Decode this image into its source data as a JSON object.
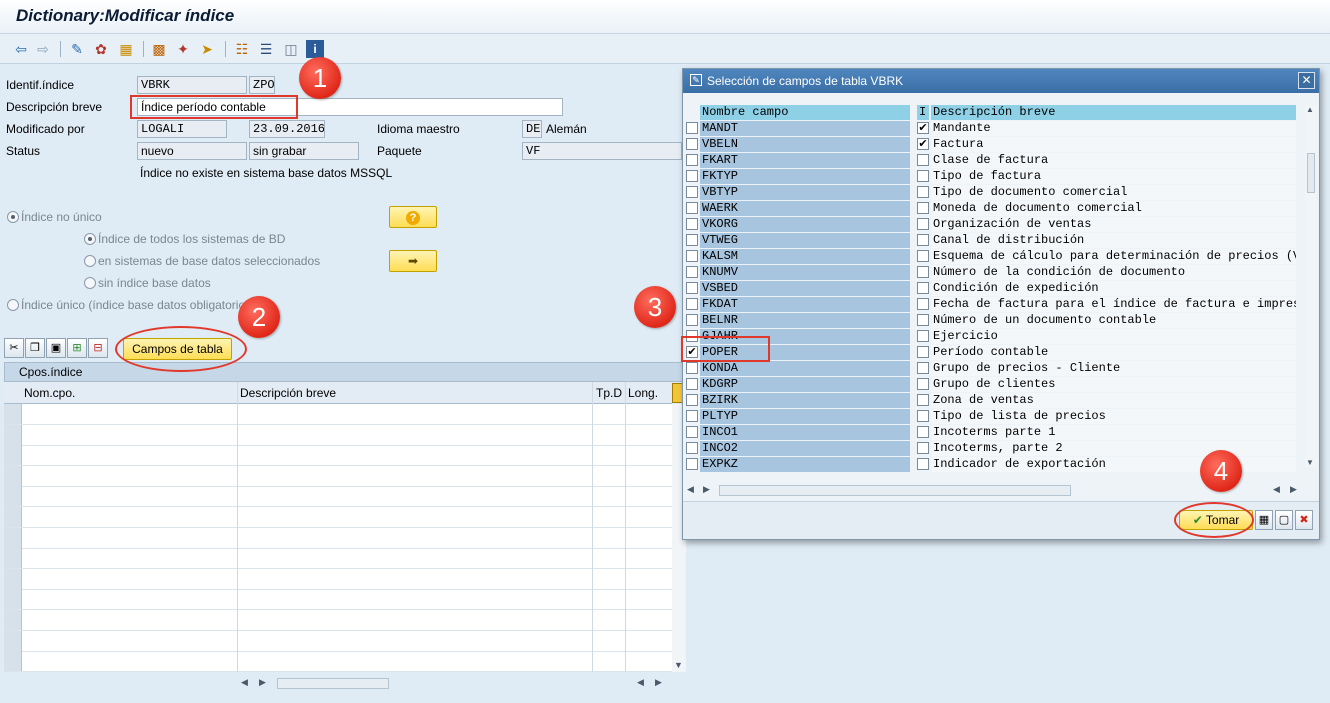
{
  "window": {
    "title": "Dictionary:Modificar índice"
  },
  "toolbar": {
    "icons": [
      "back-arrow-icon",
      "forward-arrow-icon",
      "display-change-icon",
      "activate-icon",
      "object-list-icon",
      "hierarchy-icon",
      "magic-wand-icon",
      "navigate-icon",
      "tree-icon",
      "list-icon",
      "layout-icon",
      "info-icon"
    ]
  },
  "form": {
    "id_label": "Identif.índice",
    "id_value1": "VBRK",
    "id_value2": "ZPO",
    "desc_label": "Descripción breve",
    "desc_value": "Índice período contable",
    "mod_label": "Modificado por",
    "mod_user": "LOGALI",
    "mod_date": "23.09.2016",
    "lang_label": "Idioma maestro",
    "lang_code": "DE",
    "lang_name": "Alemán",
    "status_label": "Status",
    "status_value1": "nuevo",
    "status_value2": "sin grabar",
    "package_label": "Paquete",
    "package_value": "VF",
    "info_text": "Índice no existe en sistema base datos MSSQL"
  },
  "options": {
    "non_unique": "Índice no único",
    "all_systems": "Índice de todos los sistemas de BD",
    "selected_systems": "en sistemas de base datos seleccionados",
    "no_index": "sin índice base datos",
    "unique": "Índice único (índice base datos obligatorio)"
  },
  "buttons": {
    "fields": "Campos de tabla",
    "take": "Tomar"
  },
  "table": {
    "caption": "Cpos.índice",
    "columns": [
      "Nom.cpo.",
      "Descripción breve",
      "Tp.D",
      "Long."
    ]
  },
  "dialog": {
    "title": "Selección de campos de tabla VBRK",
    "col_name": "Nombre campo",
    "col_i": "I",
    "col_desc": "Descripción breve",
    "rows": [
      {
        "name": "MANDT",
        "desc": "Mandante",
        "key": true,
        "checked": false
      },
      {
        "name": "VBELN",
        "desc": "Factura",
        "key": true,
        "checked": false
      },
      {
        "name": "FKART",
        "desc": "Clase de factura",
        "key": false,
        "checked": false
      },
      {
        "name": "FKTYP",
        "desc": "Tipo de factura",
        "key": false,
        "checked": false
      },
      {
        "name": "VBTYP",
        "desc": "Tipo de documento comercial",
        "key": false,
        "checked": false
      },
      {
        "name": "WAERK",
        "desc": "Moneda de documento comercial",
        "key": false,
        "checked": false
      },
      {
        "name": "VKORG",
        "desc": "Organización de ventas",
        "key": false,
        "checked": false
      },
      {
        "name": "VTWEG",
        "desc": "Canal de distribución",
        "key": false,
        "checked": false
      },
      {
        "name": "KALSM",
        "desc": "Esquema de cálculo para determinación de precios (Ve",
        "key": false,
        "checked": false
      },
      {
        "name": "KNUMV",
        "desc": "Número de la condición de documento",
        "key": false,
        "checked": false
      },
      {
        "name": "VSBED",
        "desc": "Condición de expedición",
        "key": false,
        "checked": false
      },
      {
        "name": "FKDAT",
        "desc": "Fecha de factura para el índice de factura e impresi",
        "key": false,
        "checked": false
      },
      {
        "name": "BELNR",
        "desc": "Número de un documento contable",
        "key": false,
        "checked": false
      },
      {
        "name": "GJAHR",
        "desc": "Ejercicio",
        "key": false,
        "checked": false
      },
      {
        "name": "POPER",
        "desc": "Período contable",
        "key": false,
        "checked": true
      },
      {
        "name": "KONDA",
        "desc": "Grupo de precios - Cliente",
        "key": false,
        "checked": false
      },
      {
        "name": "KDGRP",
        "desc": "Grupo de clientes",
        "key": false,
        "checked": false
      },
      {
        "name": "BZIRK",
        "desc": "Zona de ventas",
        "key": false,
        "checked": false
      },
      {
        "name": "PLTYP",
        "desc": "Tipo de lista de precios",
        "key": false,
        "checked": false
      },
      {
        "name": "INCO1",
        "desc": "Incoterms parte 1",
        "key": false,
        "checked": false
      },
      {
        "name": "INCO2",
        "desc": "Incoterms, parte 2",
        "key": false,
        "checked": false
      },
      {
        "name": "EXPKZ",
        "desc": "Indicador de exportación",
        "key": false,
        "checked": false
      }
    ]
  },
  "callouts": [
    "1",
    "2",
    "3",
    "4"
  ]
}
